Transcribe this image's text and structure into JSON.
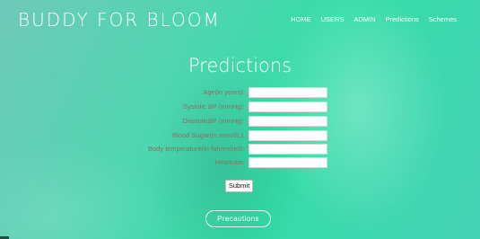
{
  "brand": {
    "name": "BUDDY FOR BLOOM"
  },
  "nav": {
    "items": [
      "HOME",
      "USERS",
      "ADMIN",
      "Predictions",
      "Schemes"
    ]
  },
  "page": {
    "title": "Predictions"
  },
  "form": {
    "fields": [
      {
        "label": "Age(in years):",
        "value": ""
      },
      {
        "label": "Systolic BP (mmHg):",
        "value": ""
      },
      {
        "label": "DiastolicBP (mmHg):",
        "value": ""
      },
      {
        "label": "Blood Sugar(in mmol/L):",
        "value": ""
      },
      {
        "label": "Body temperature(in fahrenheit):",
        "value": ""
      },
      {
        "label": "Heartrate:",
        "value": ""
      }
    ],
    "submit_label": "Submit"
  },
  "precautions": {
    "label": "Precautions"
  }
}
